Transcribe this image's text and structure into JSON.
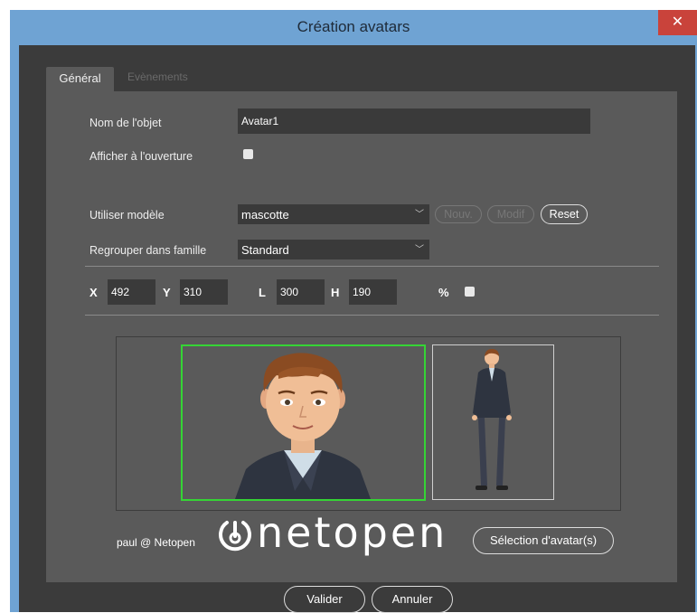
{
  "window": {
    "title": "Création avatars",
    "close_glyph": "✕"
  },
  "tabs": [
    {
      "label": "Général",
      "active": true
    },
    {
      "label": "Evènements",
      "active": false
    }
  ],
  "form": {
    "name_label": "Nom de l'objet",
    "name_value": "Avatar1",
    "show_on_open_label": "Afficher à l'ouverture",
    "model_label": "Utiliser modèle",
    "model_value": "mascotte",
    "new_label": "Nouv.",
    "modif_label": "Modif",
    "reset_label": "Reset",
    "family_label": "Regrouper dans famille",
    "family_value": "Standard",
    "x_label": "X",
    "x_value": "492",
    "y_label": "Y",
    "y_value": "310",
    "l_label": "L",
    "l_value": "300",
    "h_label": "H",
    "h_value": "190",
    "percent_label": "%"
  },
  "footer": {
    "credit": "paul @ Netopen",
    "logo_text": "netopen",
    "select_avatar_label": "Sélection d'avatar(s)",
    "validate_label": "Valider",
    "cancel_label": "Annuler"
  },
  "colors": {
    "accent_border": "#35d435",
    "titlebar": "#6fa3d3",
    "close": "#c9433b",
    "panel": "#5a5a5a"
  }
}
